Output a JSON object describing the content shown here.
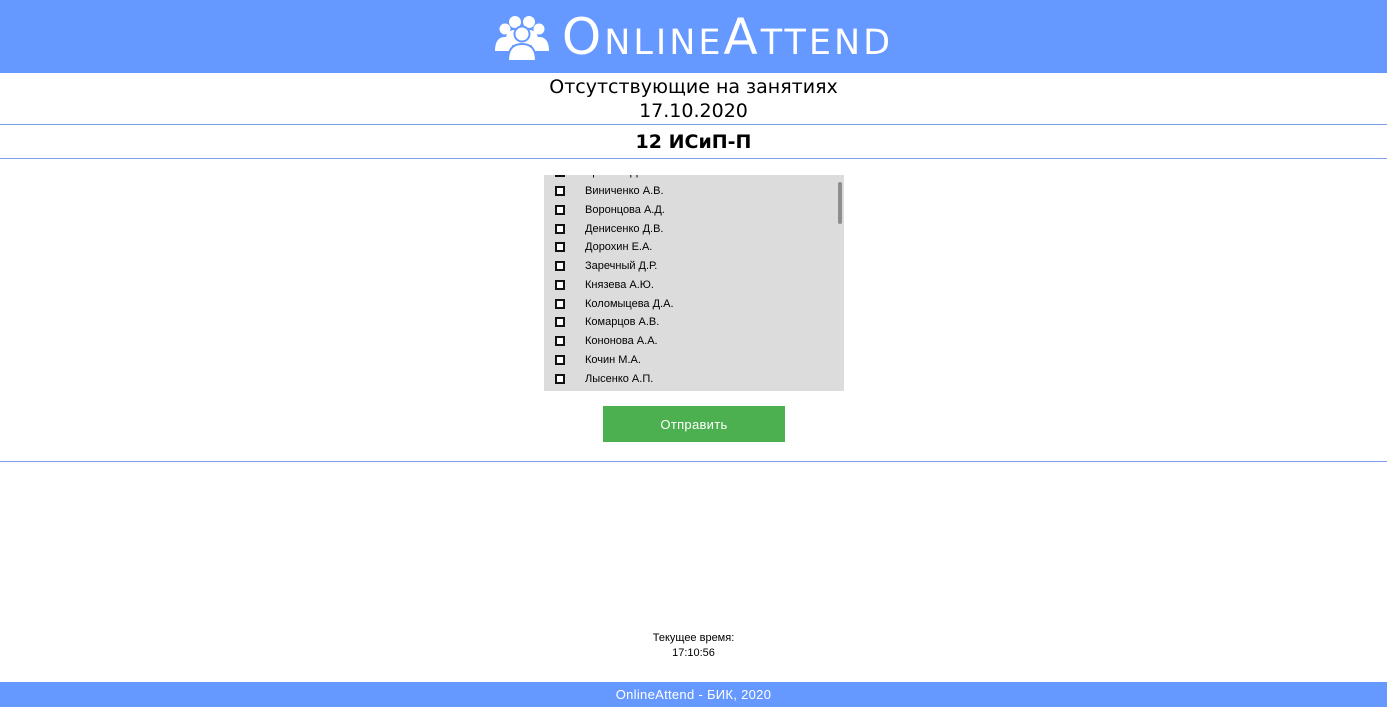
{
  "header": {
    "brand": "OnlineAttend",
    "logo_icon": "users-group-icon",
    "background": "#6699ff"
  },
  "page": {
    "title": "Отсутствующие на занятиях",
    "date": "17.10.2020",
    "group": "12 ИСиП-П"
  },
  "students": [
    {
      "name": "Братчин Д.А.",
      "checked": false
    },
    {
      "name": "Виниченко А.В.",
      "checked": false
    },
    {
      "name": "Воронцова А.Д.",
      "checked": false
    },
    {
      "name": "Денисенко Д.В.",
      "checked": false
    },
    {
      "name": "Дорохин Е.А.",
      "checked": false
    },
    {
      "name": "Заречный Д.Р.",
      "checked": false
    },
    {
      "name": "Князева А.Ю.",
      "checked": false
    },
    {
      "name": "Коломыцева Д.А.",
      "checked": false
    },
    {
      "name": "Комарцов А.В.",
      "checked": false
    },
    {
      "name": "Кононова А.А.",
      "checked": false
    },
    {
      "name": "Кочин М.А.",
      "checked": false
    },
    {
      "name": "Лысенко А.П.",
      "checked": false
    }
  ],
  "actions": {
    "submit_label": "Отправить",
    "submit_color": "#4caf50"
  },
  "clock": {
    "label": "Текущее время:",
    "time": "17:10:56"
  },
  "footer": {
    "text": "OnlineAttend - БИК, 2020"
  }
}
